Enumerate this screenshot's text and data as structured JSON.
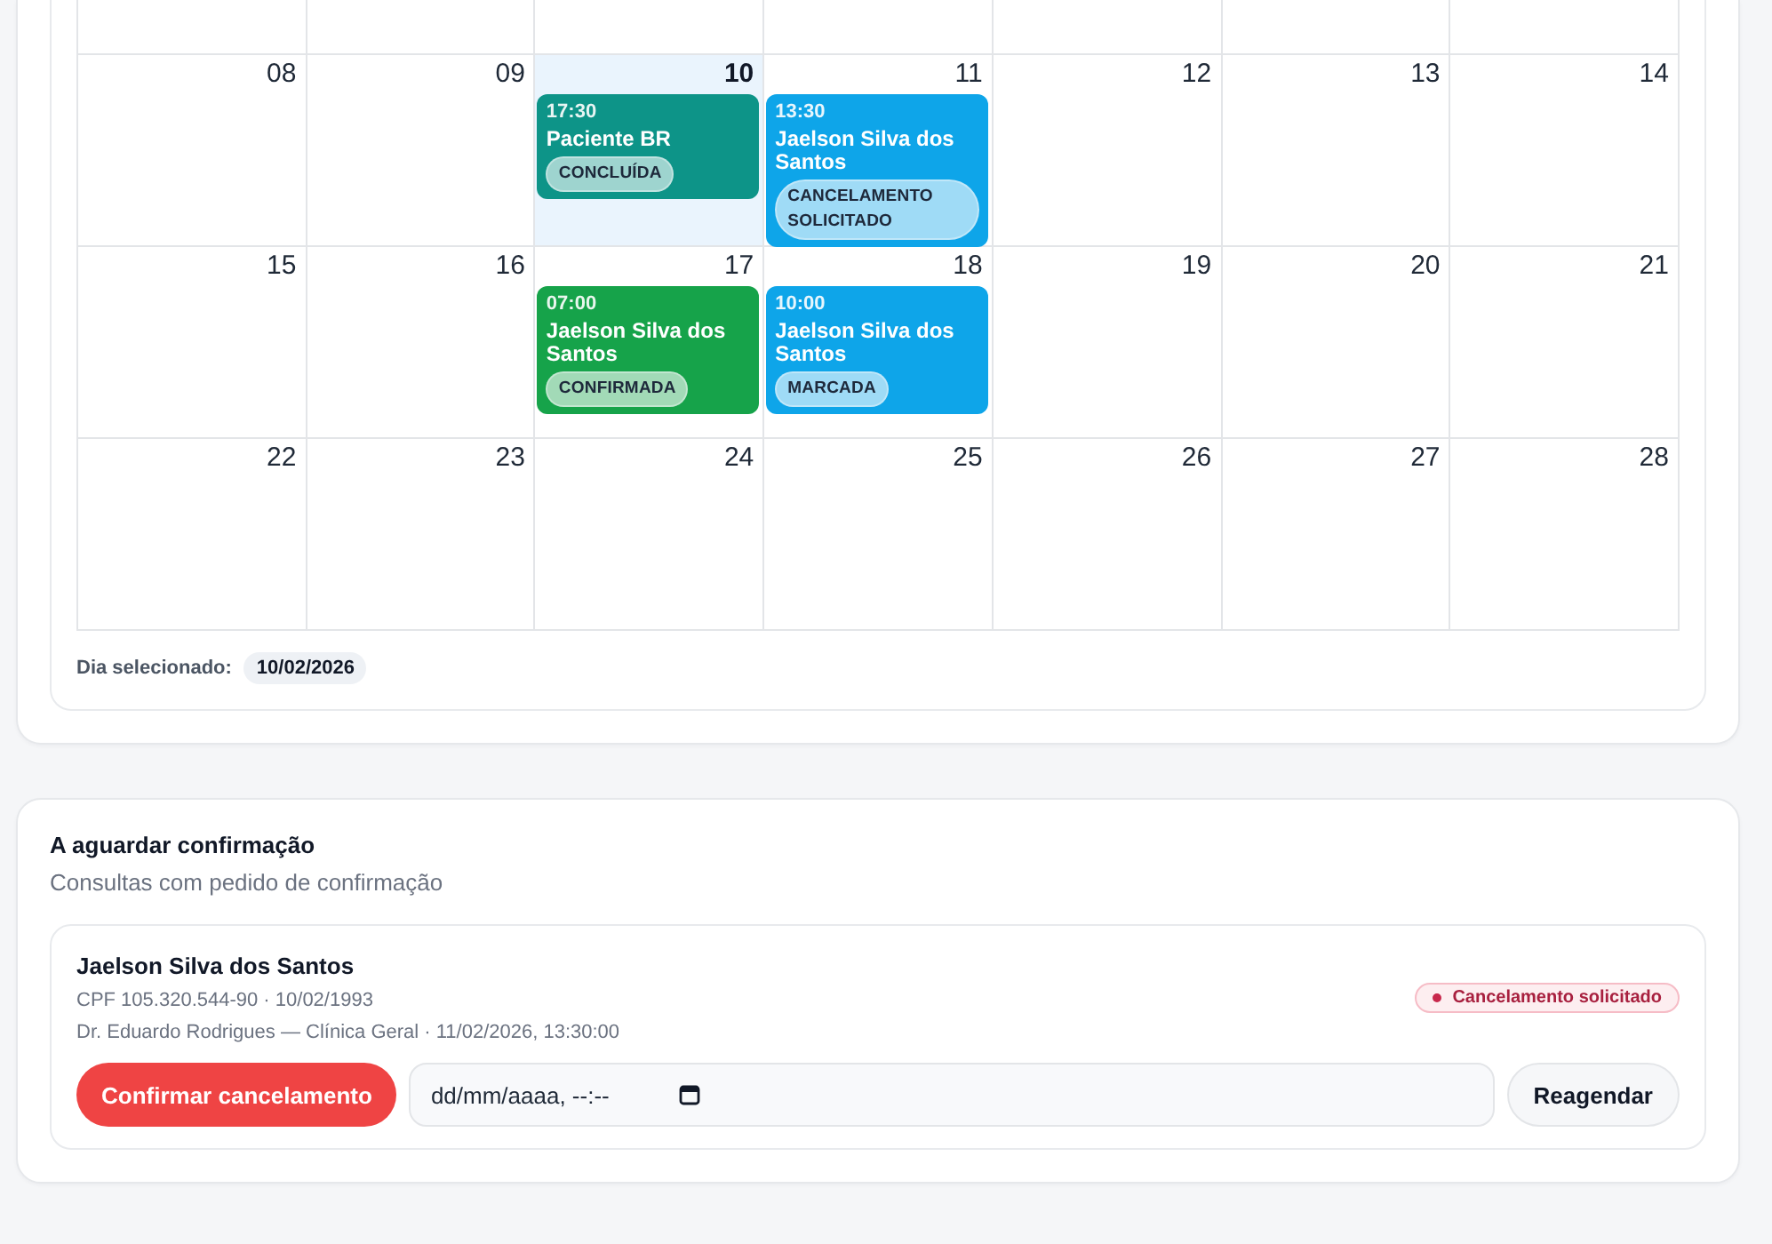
{
  "calendar": {
    "weeks": [
      {
        "days": [
          {
            "day": "08",
            "selected": false
          },
          {
            "day": "09",
            "selected": false
          },
          {
            "day": "10",
            "selected": true,
            "events": [
              {
                "time": "17:30",
                "patient": "Paciente BR",
                "status": "CONCLUÍDA",
                "color": "#0d9488"
              }
            ]
          },
          {
            "day": "11",
            "selected": false,
            "events": [
              {
                "time": "13:30",
                "patient": "Jaelson Silva dos Santos",
                "status": "CANCELAMENTO SOLICITADO",
                "color": "#0ea5e9"
              }
            ]
          },
          {
            "day": "12",
            "selected": false
          },
          {
            "day": "13",
            "selected": false
          },
          {
            "day": "14",
            "selected": false
          }
        ]
      },
      {
        "days": [
          {
            "day": "15",
            "selected": false
          },
          {
            "day": "16",
            "selected": false
          },
          {
            "day": "17",
            "selected": false,
            "events": [
              {
                "time": "07:00",
                "patient": "Jaelson Silva dos Santos",
                "status": "CONFIRMADA",
                "color": "#16a34a"
              }
            ]
          },
          {
            "day": "18",
            "selected": false,
            "events": [
              {
                "time": "10:00",
                "patient": "Jaelson Silva dos Santos",
                "status": "MARCADA",
                "color": "#0ea5e9"
              }
            ]
          },
          {
            "day": "19",
            "selected": false
          },
          {
            "day": "20",
            "selected": false
          },
          {
            "day": "21",
            "selected": false
          }
        ]
      },
      {
        "days": [
          {
            "day": "22",
            "selected": false
          },
          {
            "day": "23",
            "selected": false
          },
          {
            "day": "24",
            "selected": false
          },
          {
            "day": "25",
            "selected": false
          },
          {
            "day": "26",
            "selected": false
          },
          {
            "day": "27",
            "selected": false
          },
          {
            "day": "28",
            "selected": false
          }
        ]
      }
    ],
    "selected_date": {
      "label": "Dia selecionado:",
      "value": "10/02/2026"
    }
  },
  "pending": {
    "title": "A aguardar confirmação",
    "subtitle": "Consultas com pedido de confirmação",
    "requests": [
      {
        "patient": "Jaelson Silva dos Santos",
        "details": "CPF 105.320.544-90 · 10/02/1993",
        "appointment": "Dr. Eduardo Rodrigues — Clínica Geral · 11/02/2026, 13:30:00",
        "status": "Cancelamento solicitado",
        "confirm_button": "Confirmar cancelamento",
        "date_field": {
          "placeholder": "dd/mm/aaaa, --:--"
        },
        "reschedule_button": "Reagendar"
      }
    ]
  }
}
